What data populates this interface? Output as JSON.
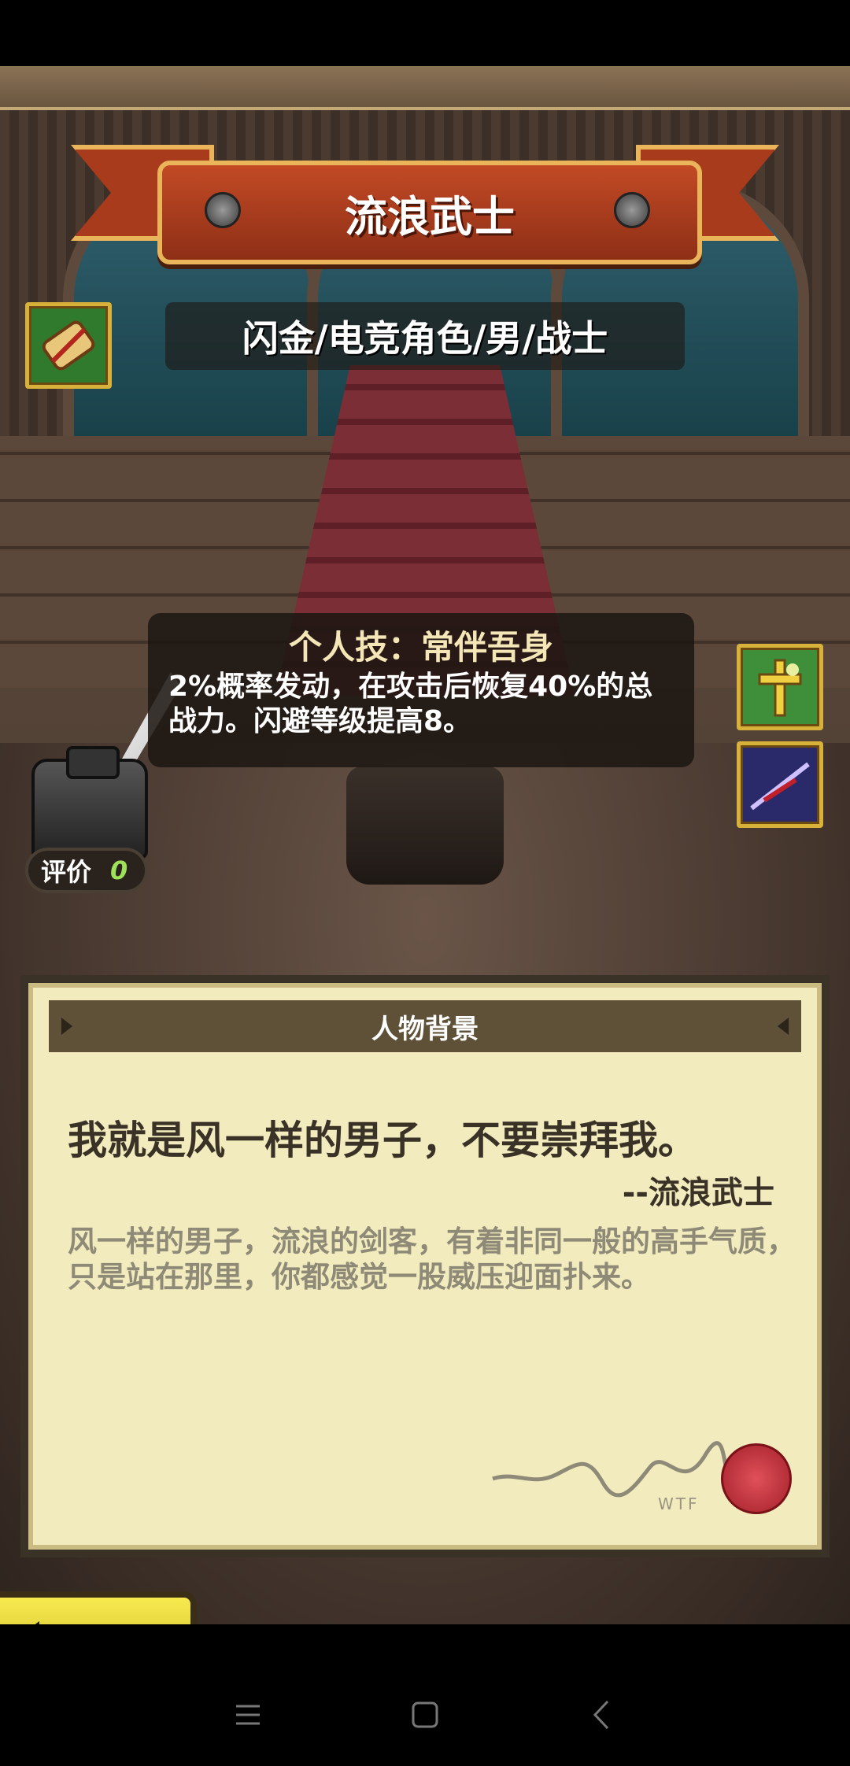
{
  "header": {
    "title": "流浪武士",
    "subtitle": "闪金/电竞角色/男/战士"
  },
  "skill": {
    "title": "个人技：常伴吾身",
    "description": "2%概率发动，在攻击后恢复40%的总战力。闪避等级提高8。"
  },
  "rating": {
    "label": "评价",
    "value": "0"
  },
  "background_panel": {
    "header": "人物背景",
    "quote": "我就是风一样的男子，不要崇拜我。",
    "author": "--流浪武士",
    "description": "风一样的男子，流浪的剑客，有着非同一般的高手气质，只是站在那里，你都感觉一股威压迎面扑来。",
    "signature_sub": "WTF"
  },
  "icons": {
    "scroll": "scroll-icon",
    "cross": "holy-cross-icon",
    "sword": "sword-icon",
    "back": "back-arrow-icon"
  },
  "colors": {
    "ribbon": "#b8421f",
    "ribbon_border": "#e9b45a",
    "panel_bg": "#f2ebbd",
    "rating_value": "#9ee25a",
    "back_button": "#e8d53a"
  }
}
